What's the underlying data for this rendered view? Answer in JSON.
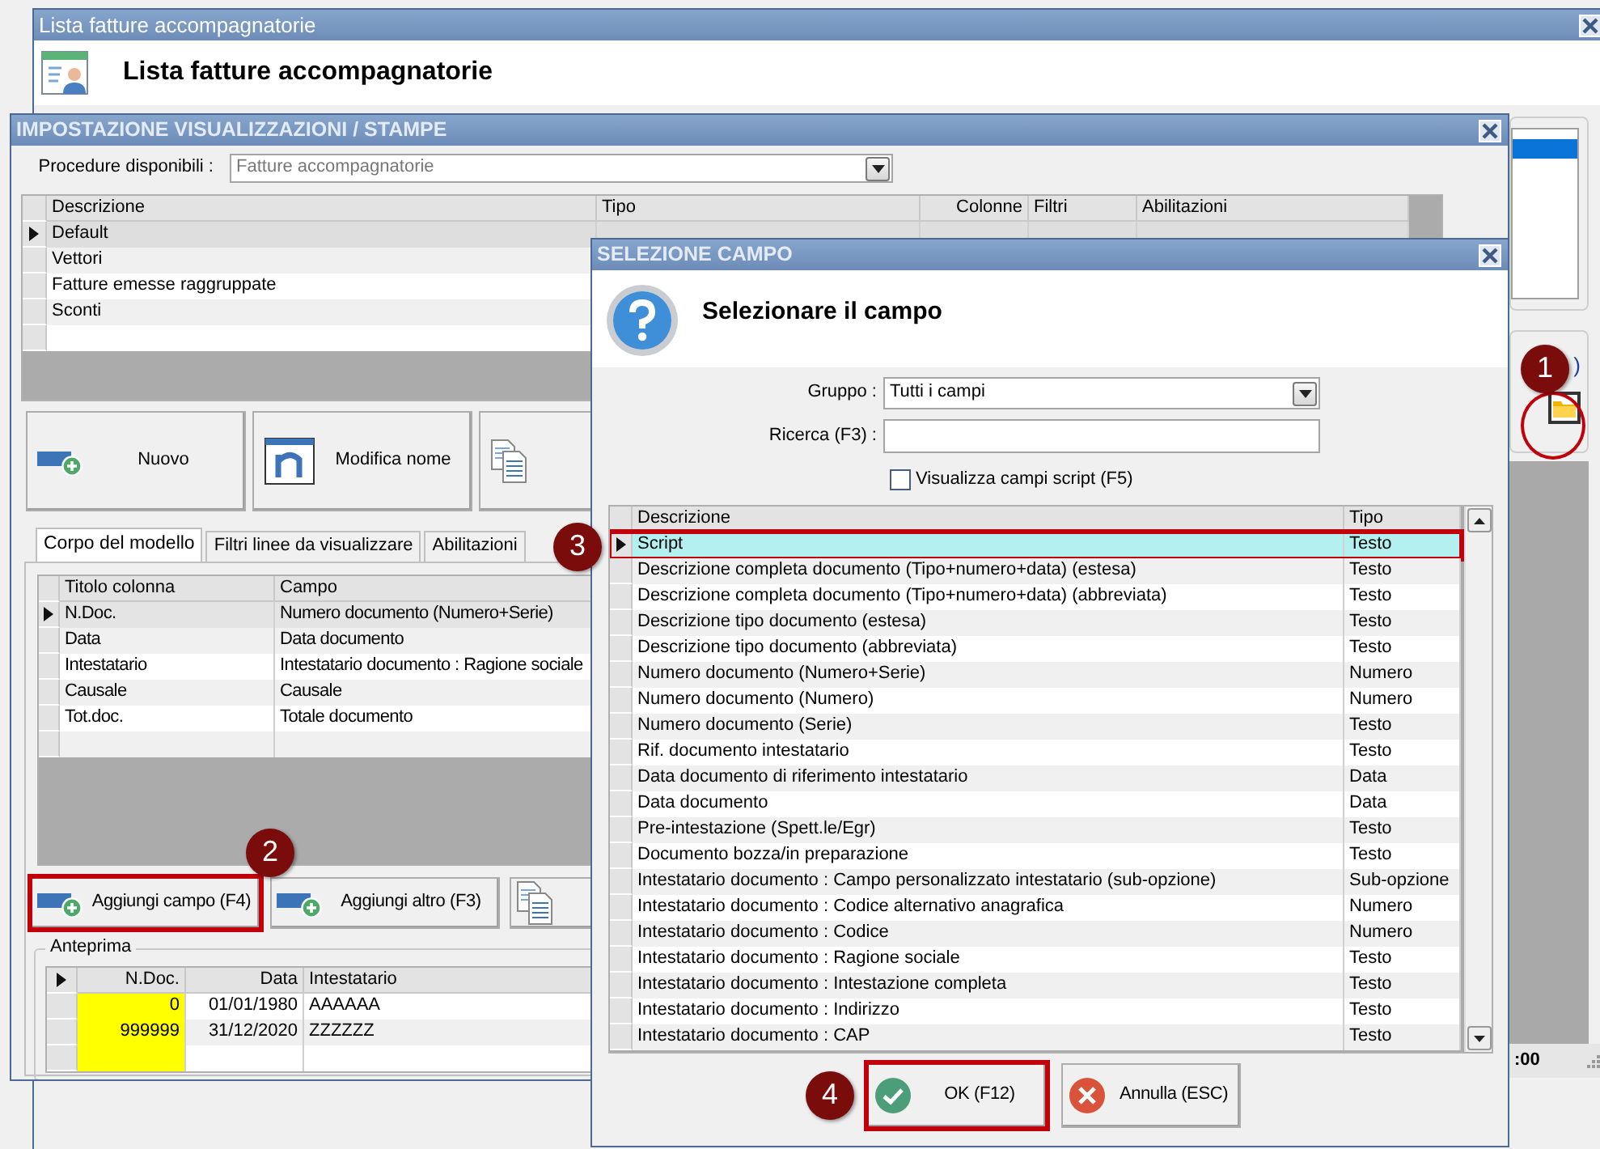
{
  "main_window": {
    "title": "Lista fatture accompagnatorie",
    "heading": "Lista fatture accompagnatorie",
    "partial_label": ")",
    "status_text": ":00"
  },
  "settings_dialog": {
    "title": "IMPOSTAZIONE VISUALIZZAZIONI / STAMPE",
    "procedure_label": "Procedure disponibili :",
    "procedure_value": "Fatture accompagnatorie",
    "models": {
      "columns": [
        "Descrizione",
        "Tipo",
        "Colonne",
        "Filtri",
        "Abilitazioni"
      ],
      "rows": [
        {
          "description": "Default",
          "selected": true
        },
        {
          "description": "Vettori",
          "selected": false
        },
        {
          "description": "Fatture emesse raggruppate",
          "selected": false
        },
        {
          "description": "Sconti",
          "selected": false
        }
      ]
    },
    "buttons": [
      {
        "kind": "add",
        "label": "Nuovo"
      },
      {
        "kind": "rename",
        "label": "Modifica nome"
      },
      {
        "kind": "copy"
      }
    ],
    "tabs": [
      {
        "label": "Corpo del modello",
        "selected": true
      },
      {
        "label": "Filtri linee da visualizzare",
        "selected": false
      },
      {
        "label": "Abilitazioni",
        "selected": false
      }
    ],
    "fields": {
      "columns": [
        "Titolo colonna",
        "Campo"
      ],
      "rows": [
        {
          "title": "N.Doc.",
          "field": "Numero documento (Numero+Serie)",
          "selected": true
        },
        {
          "title": "Data",
          "field": "Data documento",
          "selected": false
        },
        {
          "title": "Intestatario",
          "field": "Intestatario documento : Ragione sociale",
          "selected": false
        },
        {
          "title": "Causale",
          "field": "Causale",
          "selected": false
        },
        {
          "title": "Tot.doc.",
          "field": "Totale documento",
          "selected": false
        }
      ]
    },
    "field_buttons": [
      {
        "kind": "add",
        "label": "Aggiungi campo (F4)",
        "highlighted": true
      },
      {
        "kind": "add",
        "label": "Aggiungi altro (F3)",
        "highlighted": false
      },
      {
        "kind": "copy",
        "highlighted": false
      }
    ],
    "preview": {
      "title": "Anteprima",
      "columns": [
        "N.Doc.",
        "Data",
        "Intestatario"
      ],
      "rows": [
        {
          "number": "0",
          "date": "01/01/1980",
          "holder": "AAAAAA"
        },
        {
          "number": "999999",
          "date": "31/12/2020",
          "holder": "ZZZZZZ"
        }
      ]
    }
  },
  "field_dialog": {
    "title": "SELEZIONE CAMPO",
    "heading": "Selezionare il campo",
    "group_label": "Gruppo :",
    "group_value": "Tutti i campi",
    "search_label": "Ricerca (F3) :",
    "script_checkbox": {
      "label": "Visualizza campi script (F5)",
      "checked": false
    },
    "columns": [
      "Descrizione",
      "Tipo"
    ],
    "rows": [
      {
        "description": "Script",
        "type": "Testo",
        "selected": true,
        "highlighted": true
      },
      {
        "description": "Descrizione completa documento (Tipo+numero+data) (estesa)",
        "type": "Testo",
        "selected": false,
        "highlighted": false
      },
      {
        "description": "Descrizione completa documento (Tipo+numero+data) (abbreviata)",
        "type": "Testo",
        "selected": false,
        "highlighted": false
      },
      {
        "description": "Descrizione tipo documento (estesa)",
        "type": "Testo",
        "selected": false,
        "highlighted": false
      },
      {
        "description": "Descrizione tipo documento (abbreviata)",
        "type": "Testo",
        "selected": false,
        "highlighted": false
      },
      {
        "description": "Numero documento (Numero+Serie)",
        "type": "Numero",
        "selected": false,
        "highlighted": false
      },
      {
        "description": "Numero documento (Numero)",
        "type": "Numero",
        "selected": false,
        "highlighted": false
      },
      {
        "description": "Numero documento (Serie)",
        "type": "Testo",
        "selected": false,
        "highlighted": false
      },
      {
        "description": "Rif. documento intestatario",
        "type": "Testo",
        "selected": false,
        "highlighted": false
      },
      {
        "description": "Data documento di riferimento intestatario",
        "type": "Data",
        "selected": false,
        "highlighted": false
      },
      {
        "description": "Data documento",
        "type": "Data",
        "selected": false,
        "highlighted": false
      },
      {
        "description": "Pre-intestazione (Spett.le/Egr)",
        "type": "Testo",
        "selected": false,
        "highlighted": false
      },
      {
        "description": "Documento bozza/in preparazione",
        "type": "Testo",
        "selected": false,
        "highlighted": false
      },
      {
        "description": "Intestatario documento : Campo personalizzato intestatario (sub-opzione)",
        "type": "Sub-opzione",
        "selected": false,
        "highlighted": false
      },
      {
        "description": "Intestatario documento : Codice alternativo anagrafica",
        "type": "Numero",
        "selected": false,
        "highlighted": false
      },
      {
        "description": "Intestatario documento : Codice",
        "type": "Numero",
        "selected": false,
        "highlighted": false
      },
      {
        "description": "Intestatario documento : Ragione sociale",
        "type": "Testo",
        "selected": false,
        "highlighted": false
      },
      {
        "description": "Intestatario documento : Intestazione completa",
        "type": "Testo",
        "selected": false,
        "highlighted": false
      },
      {
        "description": "Intestatario documento : Indirizzo",
        "type": "Testo",
        "selected": false,
        "highlighted": false
      },
      {
        "description": "Intestatario documento : CAP",
        "type": "Testo",
        "selected": false,
        "highlighted": false
      }
    ],
    "buttons": [
      {
        "kind": "ok",
        "label": "OK (F12)",
        "highlighted": true
      },
      {
        "kind": "cancel",
        "label": "Annulla (ESC)",
        "highlighted": false
      }
    ]
  },
  "callouts": [
    "1",
    "2",
    "3",
    "4"
  ]
}
